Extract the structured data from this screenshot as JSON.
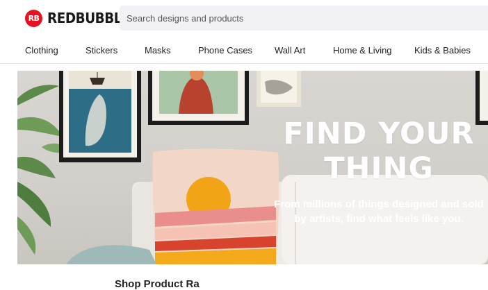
{
  "brand": {
    "logo_mark": "RB",
    "name": "REDBUBBLE",
    "accent_color": "#e41321"
  },
  "search": {
    "placeholder": "Search designs and products"
  },
  "nav": {
    "items": [
      {
        "label": "Clothing"
      },
      {
        "label": "Stickers"
      },
      {
        "label": "Masks"
      },
      {
        "label": "Phone Cases"
      },
      {
        "label": "Wall Art"
      },
      {
        "label": "Home & Living"
      },
      {
        "label": "Kids & Babies"
      }
    ]
  },
  "hero": {
    "title_line1": "FIND YOUR",
    "title_line2": "THING",
    "subtitle": "From millions of things designed and sold by artists, find what feels like you."
  },
  "section": {
    "title": "Shop Product Ra"
  }
}
